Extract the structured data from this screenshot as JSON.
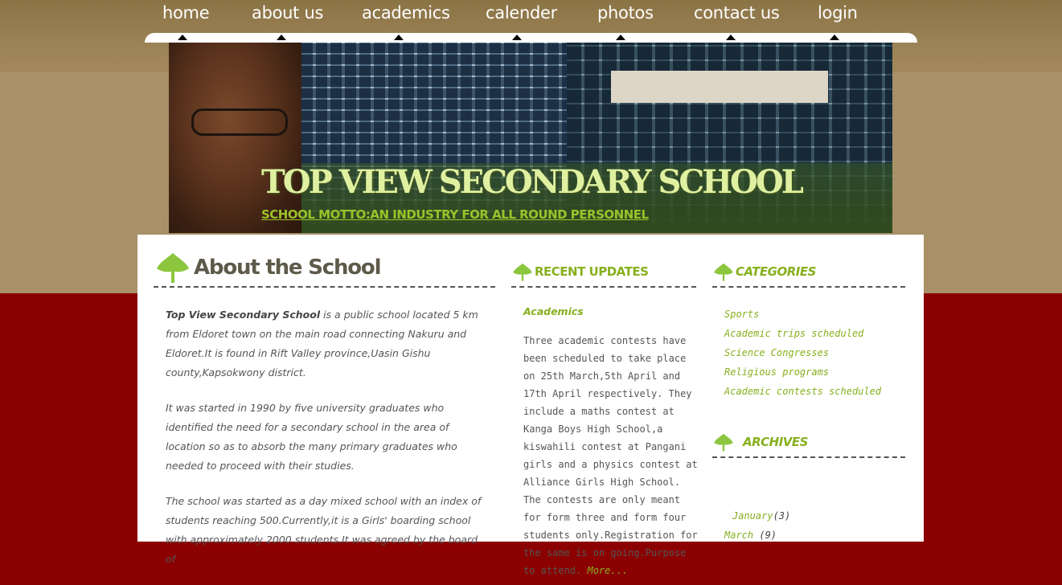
{
  "nav": {
    "items": [
      {
        "label": "home"
      },
      {
        "label": "about us"
      },
      {
        "label": "academics"
      },
      {
        "label": "calender"
      },
      {
        "label": "photos"
      },
      {
        "label": "contact us"
      },
      {
        "label": "login"
      }
    ]
  },
  "banner": {
    "title": "TOP VIEW SECONDARY SCHOOL",
    "motto": "SCHOOL MOTTO:AN INDUSTRY FOR ALL ROUND PERSONNEL"
  },
  "about": {
    "heading": "About the School",
    "p1_strong": "Top View Secondary School",
    "p1_rest": " is a public school located 5 km from Eldoret town on the main road connecting Nakuru and Eldoret.It is found in Rift Valley province,Uasin Gishu county,Kapsokwony district.",
    "p2": "It was started in 1990 by five university graduates who identified the need for a secondary school in the area of location so as to absorb the many primary graduates who needed to proceed with their studies.",
    "p3": "The school was started as a day mixed school with an index of students reaching 500.Currently,it is a Girls' boarding school with approximately 2000 students.It was agreed by the board of"
  },
  "recent": {
    "heading": "RECENT UPDATES",
    "category": "Academics",
    "body": "Three academic contests have been scheduled to take place on 25th March,5th April and 17th April respectively. They include a maths contest at Kanga Boys High School,a kiswahili contest at Pangani girls and a physics contest at Alliance Girls High School. The contests are only meant for form three and form four students only.Registration for the same is on going.Purpose to attend. ",
    "more": "More..."
  },
  "categories": {
    "heading": "CATEGORIES",
    "items": [
      {
        "label": "Sports"
      },
      {
        "label": "Academic trips scheduled"
      },
      {
        "label": "Science Congresses"
      },
      {
        "label": "Religious programs"
      },
      {
        "label": "Academic contests scheduled"
      }
    ]
  },
  "archives": {
    "heading": "ARCHIVES",
    "items": [
      {
        "month": "January",
        "count": "(3)"
      },
      {
        "month": "March",
        "count": " (9)"
      }
    ]
  },
  "colors": {
    "header_bg": "#a89168",
    "lower_bg": "#8b0000",
    "accent_green": "#87b01e"
  }
}
